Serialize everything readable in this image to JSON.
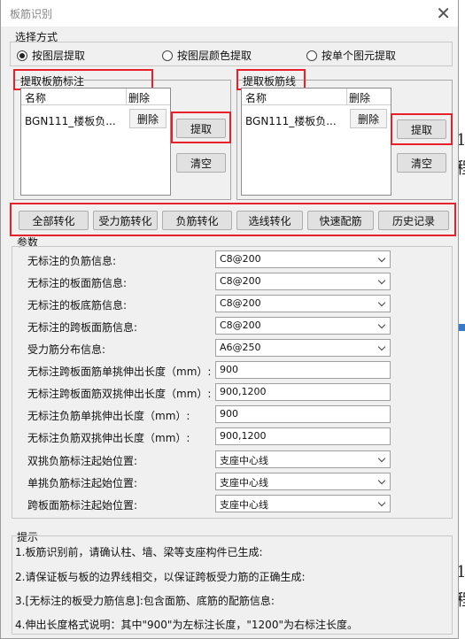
{
  "window": {
    "title": "板筋识别",
    "close_glyph": "✕"
  },
  "select_mode": {
    "label": "选择方式",
    "options": [
      {
        "label": "按图层提取",
        "selected": true
      },
      {
        "label": "按图层颜色提取",
        "selected": false
      },
      {
        "label": "按单个图元提取",
        "selected": false
      }
    ]
  },
  "left_panel": {
    "title": "提取板筋标注",
    "col_name": "名称",
    "col_delete": "删除",
    "row_name": "BGN111_楼板负...",
    "row_delete": "删除",
    "extract": "提取",
    "clear": "清空"
  },
  "right_panel": {
    "title": "提取板筋线",
    "col_name": "名称",
    "col_delete": "删除",
    "row_name": "BGN111_楼板负...",
    "row_delete": "删除",
    "extract": "提取",
    "clear": "清空"
  },
  "convert_buttons": [
    "全部转化",
    "受力筋转化",
    "负筋转化",
    "选线转化",
    "快速配筋",
    "历史记录"
  ],
  "params": {
    "label": "参数",
    "rows": [
      {
        "label": "无标注的负筋信息:",
        "value": "C8@200",
        "type": "select"
      },
      {
        "label": "无标注的板面筋信息:",
        "value": "C8@200",
        "type": "select"
      },
      {
        "label": "无标注的板底筋信息:",
        "value": "C8@200",
        "type": "select"
      },
      {
        "label": "无标注的跨板面筋信息:",
        "value": "C8@200",
        "type": "select"
      },
      {
        "label": "受力筋分布信息:",
        "value": "A6@250",
        "type": "select"
      },
      {
        "label": "无标注跨板面筋单挑伸出长度（mm）:",
        "value": "900",
        "type": "text"
      },
      {
        "label": "无标注跨板面筋双挑伸出长度（mm）:",
        "value": "900,1200",
        "type": "text"
      },
      {
        "label": "无标注负筋单挑伸出长度（mm）:",
        "value": "900",
        "type": "text"
      },
      {
        "label": "无标注负筋双挑伸出长度（mm）:",
        "value": "900,1200",
        "type": "text"
      },
      {
        "label": "双挑负筋标注起始位置:",
        "value": "支座中心线",
        "type": "select"
      },
      {
        "label": "单挑负筋标注起始位置:",
        "value": "支座中心线",
        "type": "select"
      },
      {
        "label": "跨板面筋标注起始位置:",
        "value": "支座中心线",
        "type": "select"
      }
    ]
  },
  "tips": {
    "label": "提示",
    "lines": [
      "1.板筋识别前，请确认柱、墙、梁等支座构件已生成:",
      "2.请保证板与板的边界线相交，以保证跨板受力筋的正确生成:",
      "3.[无标注的板受力筋信息]:包含面筋、底筋的配筋信息:",
      "4.伸出长度格式说明：其中\"900\"为左标注长度，\"1200\"为右标注长度。"
    ]
  },
  "background_fragments": [
    "1",
    "程",
    "1",
    "程"
  ],
  "colors": {
    "highlight": "#e8202a",
    "accent": "#3a78c8"
  }
}
